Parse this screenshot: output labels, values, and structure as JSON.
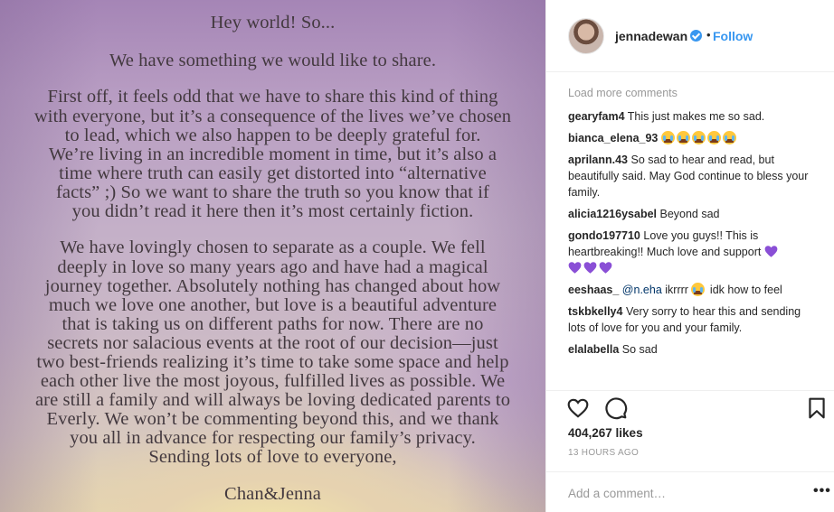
{
  "post": {
    "note_lines": [
      "Hey world!    So...",
      "We have something we would like to share.",
      "First off, it feels odd that we have to share this kind of thing",
      "with everyone, but it’s a consequence of the lives we’ve chosen",
      "to lead, which we also happen to be deeply grateful for.",
      "We’re living in an incredible moment in time, but it’s also a",
      "time where truth can easily get distorted into “alternative",
      "facts” ;)    So we want to share the truth so you know that if",
      "you didn’t read it here then it’s most certainly fiction.",
      "We have lovingly chosen to separate as a couple.    We fell",
      "deeply in love so many years ago and have had a magical",
      "journey together.    Absolutely nothing has changed about how",
      "much we love one another, but love is a beautiful adventure",
      "that is taking us on different paths for now.    There are no",
      "secrets nor salacious events at the root of our decision—just",
      "two best-friends realizing it’s time to take some space and help",
      "each other live the most joyous, fulfilled lives as possible.  We",
      "are still a family and will always be loving dedicated parents to",
      "Everly. We won’t be commenting beyond this, and we thank",
      "you all in advance for respecting our family’s privacy.",
      "Sending lots of love to everyone,",
      "Chan&Jenna"
    ]
  },
  "header": {
    "username": "jennadewan",
    "separator": "•",
    "follow_label": "Follow",
    "verified_icon": "verified-badge-icon"
  },
  "comments": {
    "load_more": "Load more comments",
    "items": [
      {
        "user": "gearyfam4",
        "text": "This just makes me so sad."
      },
      {
        "user": "bianca_elena_93",
        "text": ""
      },
      {
        "user": "aprilann.43",
        "text": "So sad to hear and read, but beautifully said. May God continue to bless your family."
      },
      {
        "user": "alicia1216ysabel",
        "text": "Beyond sad"
      },
      {
        "user": "gondo197710",
        "text": "Love you guys!! This is heartbreaking!! Much love and support"
      },
      {
        "user": "eeshaas_",
        "mention": "@n.eha",
        "text_a": "ikrrrr",
        "text_b": "idk how to feel"
      },
      {
        "user": "tskbkelly4",
        "text": "Very sorry to hear this and sending lots of love for you and your family."
      },
      {
        "user": "elalabella",
        "text": "So sad"
      }
    ]
  },
  "actions": {
    "likes": "404,267 likes",
    "time": "13 HOURS AGO",
    "like_icon": "heart-outline-icon",
    "comment_icon": "speech-bubble-icon",
    "save_icon": "bookmark-icon"
  },
  "add_comment": {
    "placeholder": "Add a comment…",
    "more_label": "•••"
  },
  "colors": {
    "accent": "#3897f0",
    "muted": "#999999",
    "text": "#262626",
    "heart_emoji": "#8a4fd6"
  }
}
